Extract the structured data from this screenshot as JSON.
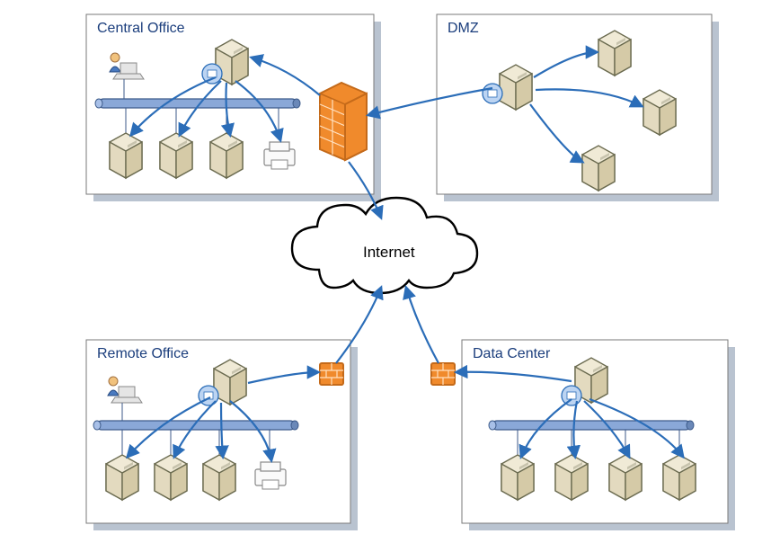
{
  "diagram": {
    "cloud_label": "Internet",
    "zones": {
      "central_office": {
        "label": "Central Office"
      },
      "dmz": {
        "label": "DMZ"
      },
      "remote_office": {
        "label": "Remote Office"
      },
      "data_center": {
        "label": "Data Center"
      }
    },
    "nodes": {
      "central_office": {
        "user_workstation": 1,
        "lan_switch": 1,
        "main_server": 1,
        "servers": 3,
        "printer": 1
      },
      "dmz": {
        "gateway_server": 1,
        "servers": 3
      },
      "remote_office": {
        "user_workstation": 1,
        "lan_switch": 1,
        "main_server": 1,
        "servers": 3,
        "printer": 1
      },
      "data_center": {
        "main_server": 1,
        "lan_switch": 1,
        "servers": 4
      }
    },
    "firewalls": {
      "main": 1,
      "remote_office": 1,
      "data_center": 1
    },
    "connections": [
      {
        "from": "dmz.gateway",
        "to": "firewall.main"
      },
      {
        "from": "firewall.main",
        "to": "central_office.main_server"
      },
      {
        "from": "firewall.main",
        "to": "internet"
      },
      {
        "from": "firewall.remote_office",
        "to": "internet"
      },
      {
        "from": "firewall.data_center",
        "to": "internet"
      },
      {
        "from": "central_office.main_server",
        "to": "central_office.servers[0..2]"
      },
      {
        "from": "central_office.main_server",
        "to": "central_office.printer"
      },
      {
        "from": "remote_office.main_server",
        "to": "remote_office.servers[0..2]"
      },
      {
        "from": "remote_office.main_server",
        "to": "remote_office.printer"
      },
      {
        "from": "remote_office.main_server",
        "to": "firewall.remote_office"
      },
      {
        "from": "data_center.main_server",
        "to": "data_center.servers[0..3]"
      },
      {
        "from": "data_center.main_server",
        "to": "firewall.data_center"
      },
      {
        "from": "dmz.gateway",
        "to": "dmz.servers[0..2]"
      }
    ],
    "colors": {
      "arrow": "#2b6db8",
      "label": "#1a3d7c",
      "firewall": "#f08a2c",
      "server": "#f0ead6",
      "panel_shadow": "#b9c3d0"
    }
  }
}
